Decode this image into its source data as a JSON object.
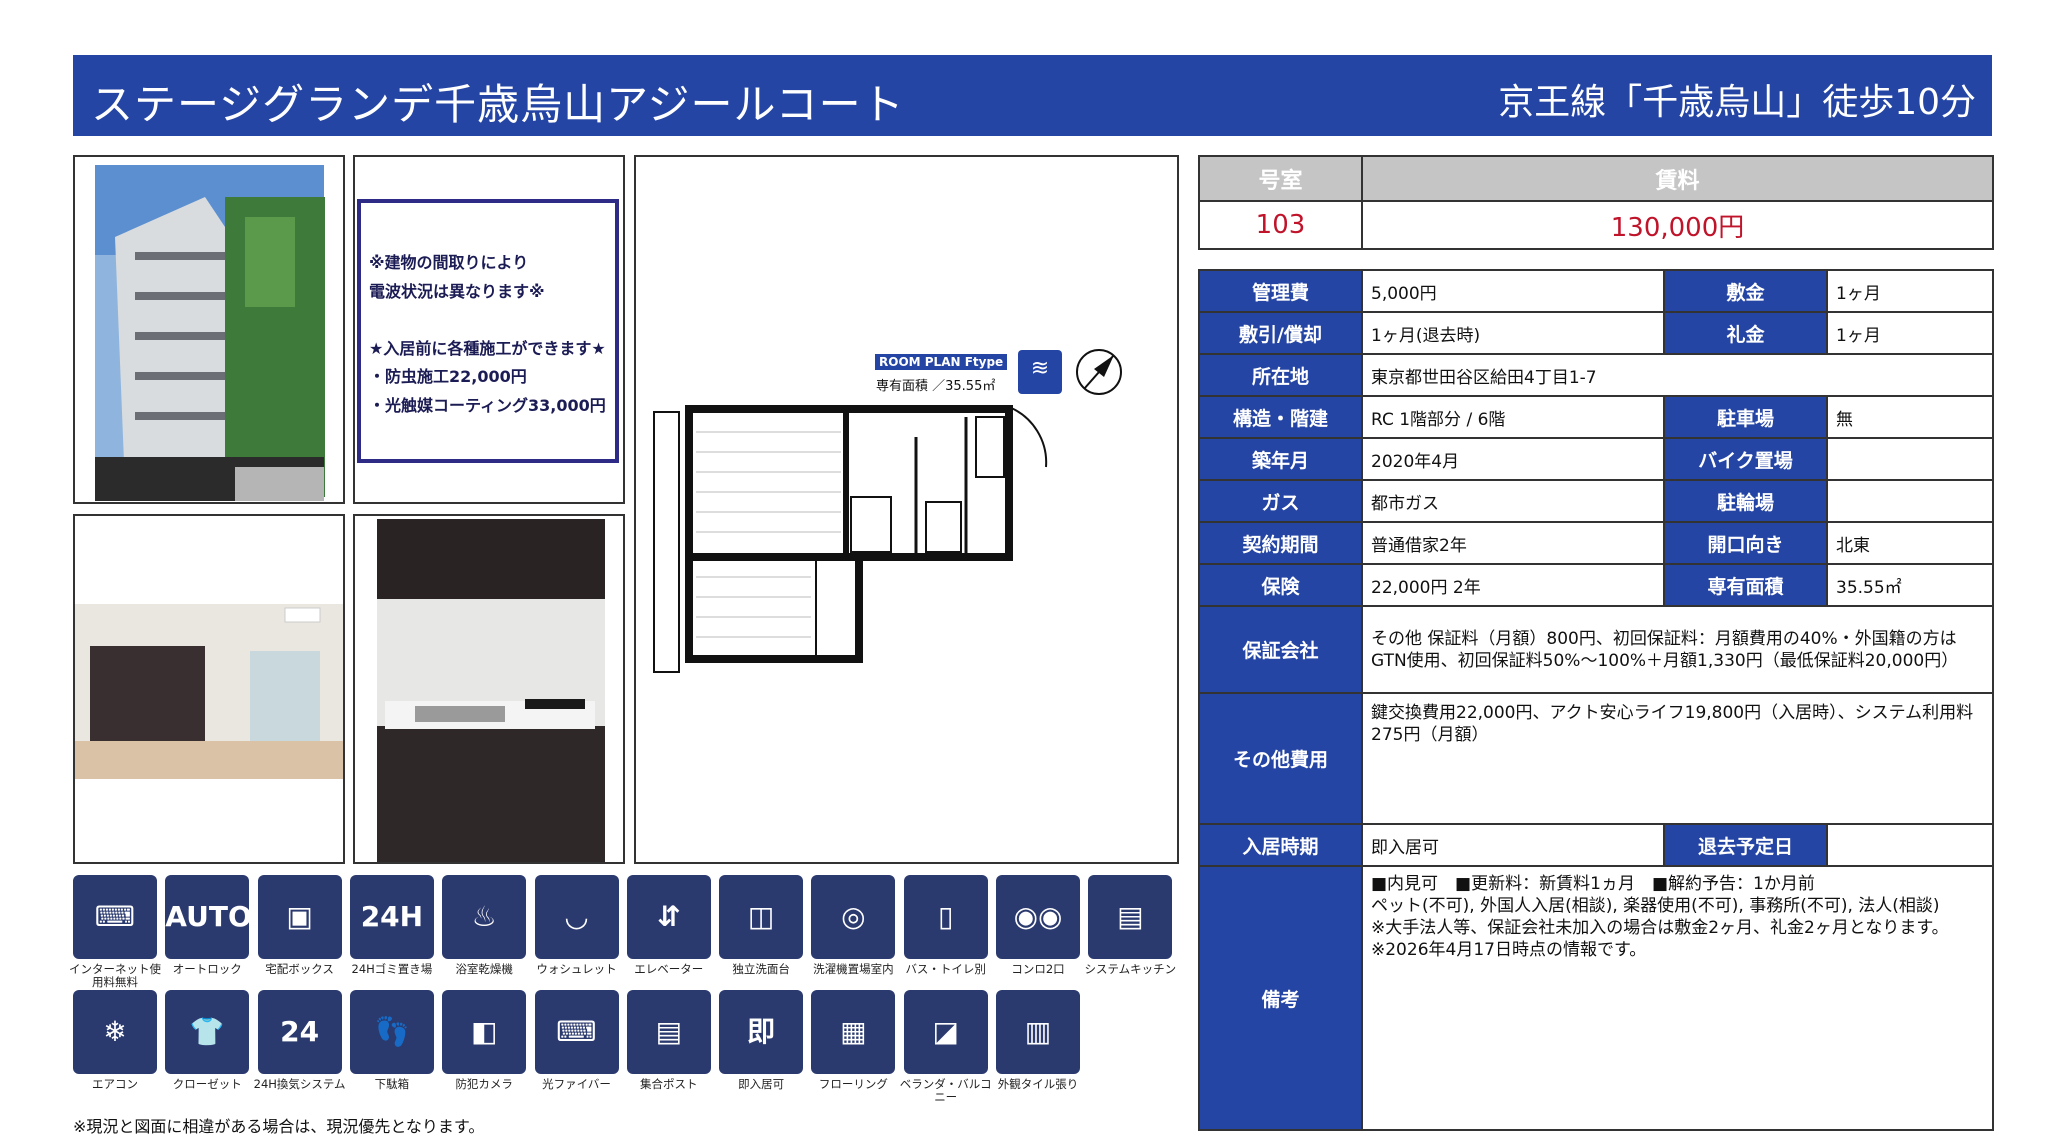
{
  "header": {
    "title": "ステージグランデ千歳烏山アジールコート",
    "station": "京王線「千歳烏山」徒歩10分"
  },
  "note_lines": [
    "※建物の間取りにより",
    "電波状況は異なります※",
    "",
    "★入居前に各種施工ができます★",
    "・防虫施工22,000円",
    "・光触媒コーティング33,000円"
  ],
  "floorplan": {
    "tag": "ROOM PLAN Ftype",
    "area": "専有面積 ／35.55㎡"
  },
  "amenities_row1": [
    "インターネット使用料無料",
    "オートロック",
    "宅配ボックス",
    "24Hゴミ置き場",
    "浴室乾燥機",
    "ウォシュレット",
    "エレベーター",
    "独立洗面台",
    "洗濯機置場室内",
    "バス・トイレ別",
    "コンロ2口",
    "システムキッチン"
  ],
  "amenities_row2": [
    "エアコン",
    "クローゼット",
    "24H換気システム",
    "下駄箱",
    "防犯カメラ",
    "光ファイバー",
    "集合ポスト",
    "即入居可",
    "フローリング",
    "ベランダ・バルコニー",
    "外観タイル張り"
  ],
  "footnote": "※現況と図面に相違がある場合は、現況優先となります。",
  "summary": {
    "room_label": "号室",
    "rent_label": "賃料",
    "room": "103",
    "rent": "130,000円"
  },
  "details": {
    "kanri_label": "管理費",
    "kanri": "5,000円",
    "shikikin_label": "敷金",
    "shikikin": "1ヶ月",
    "shikibiki_label": "敷引/償却",
    "shikibiki": "1ヶ月(退去時)",
    "reikin_label": "礼金",
    "reikin": "1ヶ月",
    "address_label": "所在地",
    "address": "東京都世田谷区給田4丁目1-7",
    "structure_label": "構造・階建",
    "structure": "RC 1階部分 / 6階",
    "parking_label": "駐車場",
    "parking": "無",
    "built_label": "築年月",
    "built": "2020年4月",
    "bike_label": "バイク置場",
    "bike": "",
    "gas_label": "ガス",
    "gas": "都市ガス",
    "bicycle_label": "駐輪場",
    "bicycle": "",
    "contract_label": "契約期間",
    "contract": "普通借家2年",
    "facing_label": "開口向き",
    "facing": "北東",
    "insurance_label": "保険",
    "insurance": "22,000円 2年",
    "area_label": "専有面積",
    "area": "35.55㎡",
    "guarantor_label": "保証会社",
    "guarantor": "その他 保証料（月額）800円、初回保証料：月額費用の40%・外国籍の方はGTN使用、初回保証料50%～100%＋月額1,330円（最低保証料20,000円）",
    "other_label": "その他費用",
    "other": "鍵交換費用22,000円、アクト安心ライフ19,800円（入居時）、システム利用料275円（月額）",
    "movein_label": "入居時期",
    "movein": "即入居可",
    "moveout_label": "退去予定日",
    "moveout": "",
    "remarks_label": "備考",
    "remarks": [
      "■内見可　■更新料：新賃料1ヵ月　■解約予告：1か月前",
      "ペット(不可), 外国人入居(相談), 楽器使用(不可), 事務所(不可), 法人(相談)",
      "※大手法人等、保証会社未加入の場合は敷金2ヶ月、礼金2ヶ月となります。",
      "※2026年4月17日時点の情報です。"
    ]
  },
  "colors": {
    "brand": "#2545a5",
    "price": "#c0142b",
    "icon_bg": "#2b3a6e"
  }
}
